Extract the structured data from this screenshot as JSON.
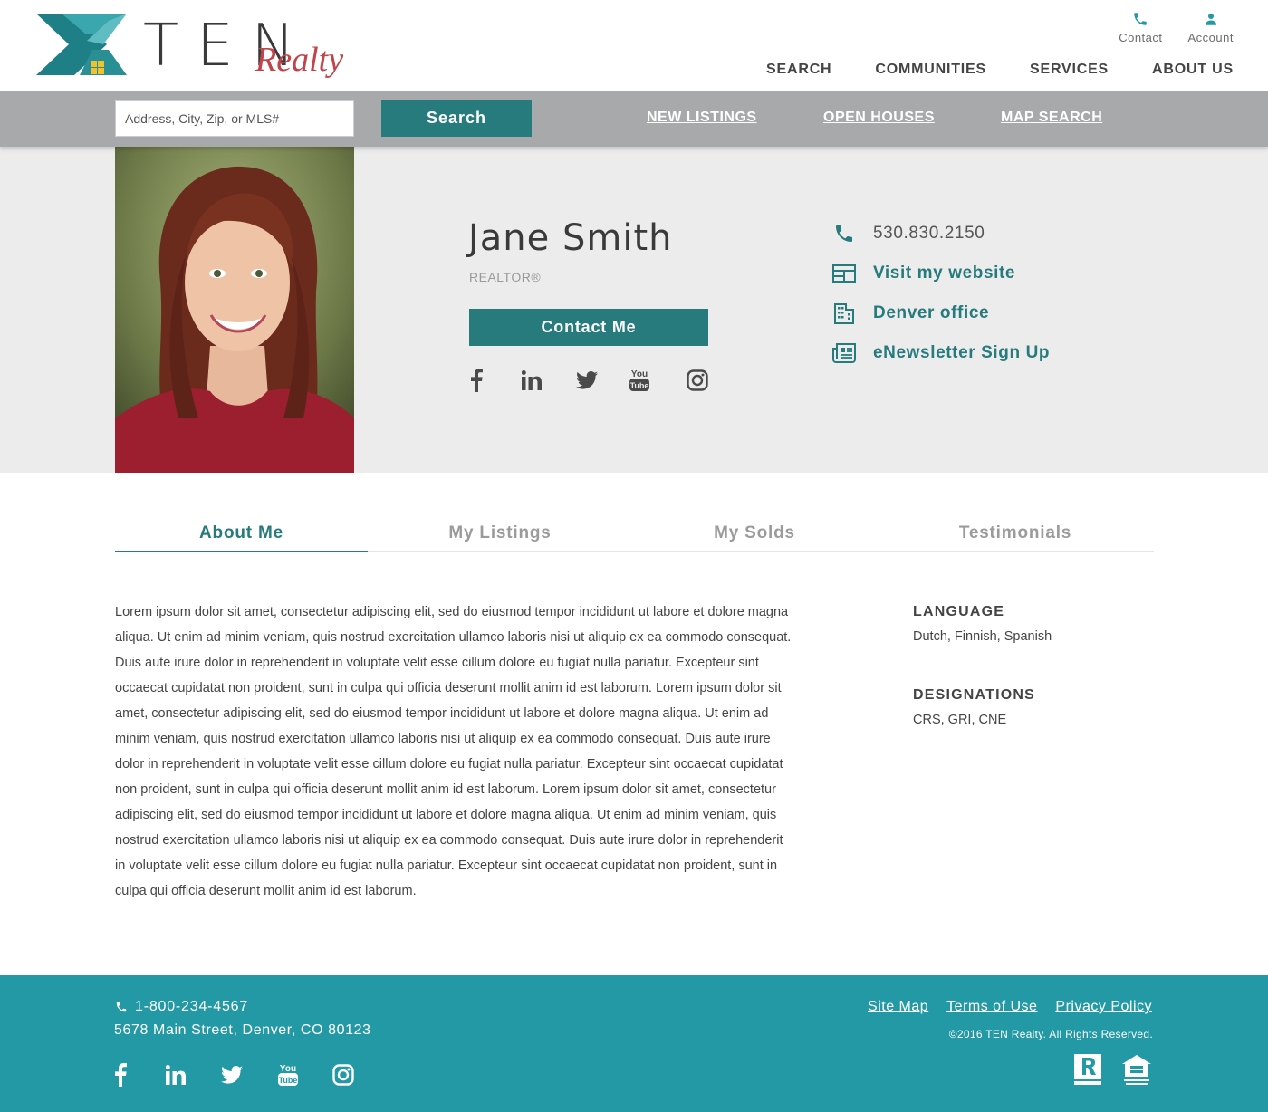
{
  "brand": {
    "ten": "TEN",
    "realty": "Realty",
    "colors": {
      "teal": "#277b7d",
      "teal_light": "#2399a6",
      "logo_teal": "#2a8f95",
      "logo_yellow": "#f2c12e",
      "logo_red": "#c0454a"
    }
  },
  "header": {
    "utils": [
      {
        "label": "Contact",
        "icon": "phone-icon"
      },
      {
        "label": "Account",
        "icon": "user-icon"
      }
    ],
    "nav": [
      "SEARCH",
      "COMMUNITIES",
      "SERVICES",
      "ABOUT US"
    ]
  },
  "search": {
    "placeholder": "Address, City, Zip, or MLS#",
    "button_label": "Search",
    "links": [
      "NEW LISTINGS",
      "OPEN HOUSES",
      "MAP SEARCH"
    ]
  },
  "agent": {
    "name": "Jane Smith",
    "title": "REALTOR®",
    "contact_button": "Contact Me",
    "social": [
      "facebook-icon",
      "linkedin-icon",
      "twitter-icon",
      "youtube-icon",
      "instagram-icon"
    ],
    "contact": {
      "phone": "530.830.2150",
      "website": "Visit my website",
      "office": "Denver office",
      "newsletter": "eNewsletter Sign Up"
    }
  },
  "tabs": [
    "About Me",
    "My Listings",
    "My Solds",
    "Testimonials"
  ],
  "active_tab": "About Me",
  "about": {
    "body": "Lorem ipsum dolor sit amet, consectetur adipiscing elit, sed do eiusmod tempor incididunt ut labore et dolore magna aliqua. Ut enim ad minim veniam, quis nostrud exercitation ullamco laboris nisi ut aliquip ex ea commodo consequat. Duis aute irure dolor in reprehenderit in voluptate velit esse cillum dolore eu fugiat nulla pariatur. Excepteur sint occaecat cupidatat non proident, sunt in culpa qui officia deserunt mollit anim id est laborum. Lorem ipsum dolor sit amet, consectetur adipiscing elit, sed do eiusmod tempor incididunt ut labore et dolore magna aliqua. Ut enim ad minim veniam, quis nostrud exercitation ullamco laboris nisi ut aliquip ex ea commodo consequat. Duis aute irure dolor in reprehenderit in voluptate velit esse cillum dolore eu fugiat nulla pariatur. Excepteur sint occaecat cupidatat non proident, sunt in culpa qui officia deserunt mollit anim id est laborum. Lorem ipsum dolor sit amet, consectetur adipiscing elit, sed do eiusmod tempor incididunt ut labore et dolore magna aliqua. Ut enim ad minim veniam, quis nostrud exercitation ullamco laboris nisi ut aliquip ex ea commodo consequat. Duis aute irure dolor in reprehenderit in voluptate velit esse cillum dolore eu fugiat nulla pariatur. Excepteur sint occaecat cupidatat non proident, sunt in culpa qui officia deserunt mollit anim id est laborum.",
    "language_heading": "LANGUAGE",
    "languages": "Dutch, Finnish, Spanish",
    "designations_heading": "DESIGNATIONS",
    "designations": "CRS, GRI, CNE"
  },
  "footer": {
    "phone": "1-800-234-4567",
    "address": "5678 Main Street, Denver, CO 80123",
    "links": [
      "Site Map",
      "Terms of Use",
      "Privacy Policy"
    ],
    "copyright": "©2016 TEN Realty. All Rights Reserved.",
    "badges": [
      "realtor-logo-icon",
      "equal-housing-icon"
    ],
    "social": [
      "facebook-icon",
      "linkedin-icon",
      "twitter-icon",
      "youtube-icon",
      "instagram-icon"
    ]
  }
}
